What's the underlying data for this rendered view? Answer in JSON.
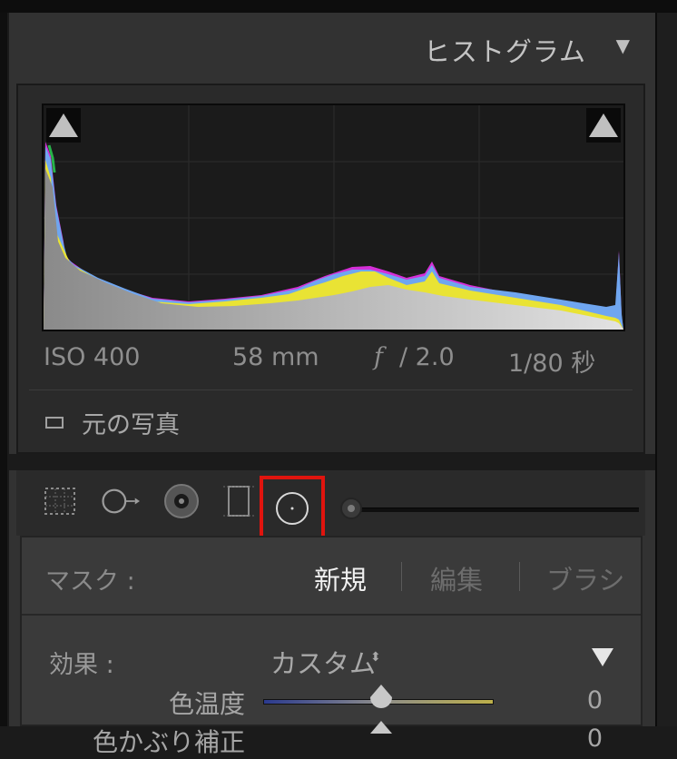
{
  "histogram": {
    "title": "ヒストグラム",
    "exif": {
      "iso": "ISO 400",
      "focal_length": "58 mm",
      "f_symbol": "f",
      "aperture": "/ 2.0",
      "shutter": "1/80 秒"
    },
    "original_photo_label": "元の写真"
  },
  "tools": {
    "items": [
      "crop-overlay",
      "spot-removal",
      "red-eye",
      "graduated-filter",
      "radial-filter"
    ],
    "selected": "radial-filter"
  },
  "mask": {
    "label": "マスク :",
    "modes": [
      "新規",
      "編集",
      "ブラシ"
    ],
    "active_mode": "新規"
  },
  "effect": {
    "label": "効果 :",
    "preset": "カスタム",
    "updown": "⬍"
  },
  "params": [
    {
      "label": "色温度",
      "value": "0"
    },
    {
      "label": "色かぶり補正",
      "value": "0"
    }
  ],
  "colors": {
    "selection_highlight": "#e0140e",
    "panel_bg": "#323232",
    "active_text": "#f0f0f0"
  }
}
